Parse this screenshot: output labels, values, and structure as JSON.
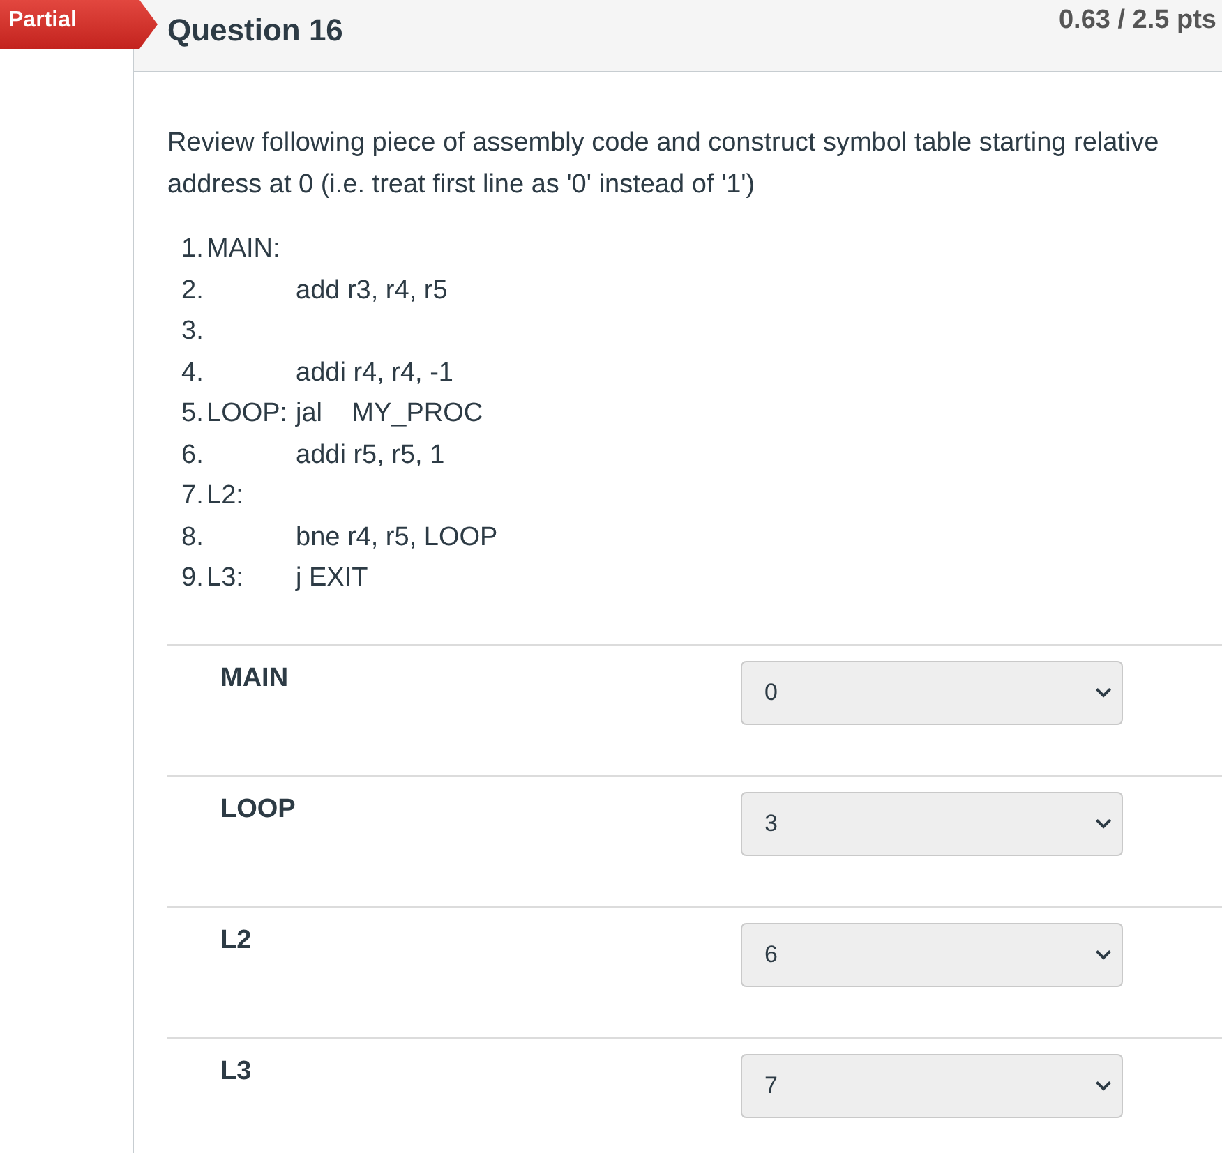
{
  "status_badge": {
    "label": "Partial"
  },
  "question": {
    "title": "Question 16",
    "score": "0.63 / 2.5 pts"
  },
  "prompt": "Review following piece of assembly code and construct symbol table starting relative address at 0 (i.e. treat first line as '0' instead of '1')",
  "code_lines": [
    {
      "number": "1.",
      "label": "MAIN:"
    },
    {
      "number": "2.",
      "instruction": "add r3, r4, r5"
    },
    {
      "number": "3."
    },
    {
      "number": "4.",
      "instruction": "addi r4, r4, -1"
    },
    {
      "number": "5.",
      "label": "LOOP:",
      "instruction": "jal    MY_PROC"
    },
    {
      "number": "6.",
      "instruction": "addi r5, r5, 1"
    },
    {
      "number": "7.",
      "label": "L2:"
    },
    {
      "number": "8.",
      "instruction": "bne r4, r5, LOOP"
    },
    {
      "number": "9.",
      "label": "L3:",
      "instruction": "j EXIT"
    }
  ],
  "answers": [
    {
      "label": "MAIN",
      "value": "0"
    },
    {
      "label": "LOOP",
      "value": "3"
    },
    {
      "label": "L2",
      "value": "6"
    },
    {
      "label": "L3",
      "value": "7"
    }
  ]
}
